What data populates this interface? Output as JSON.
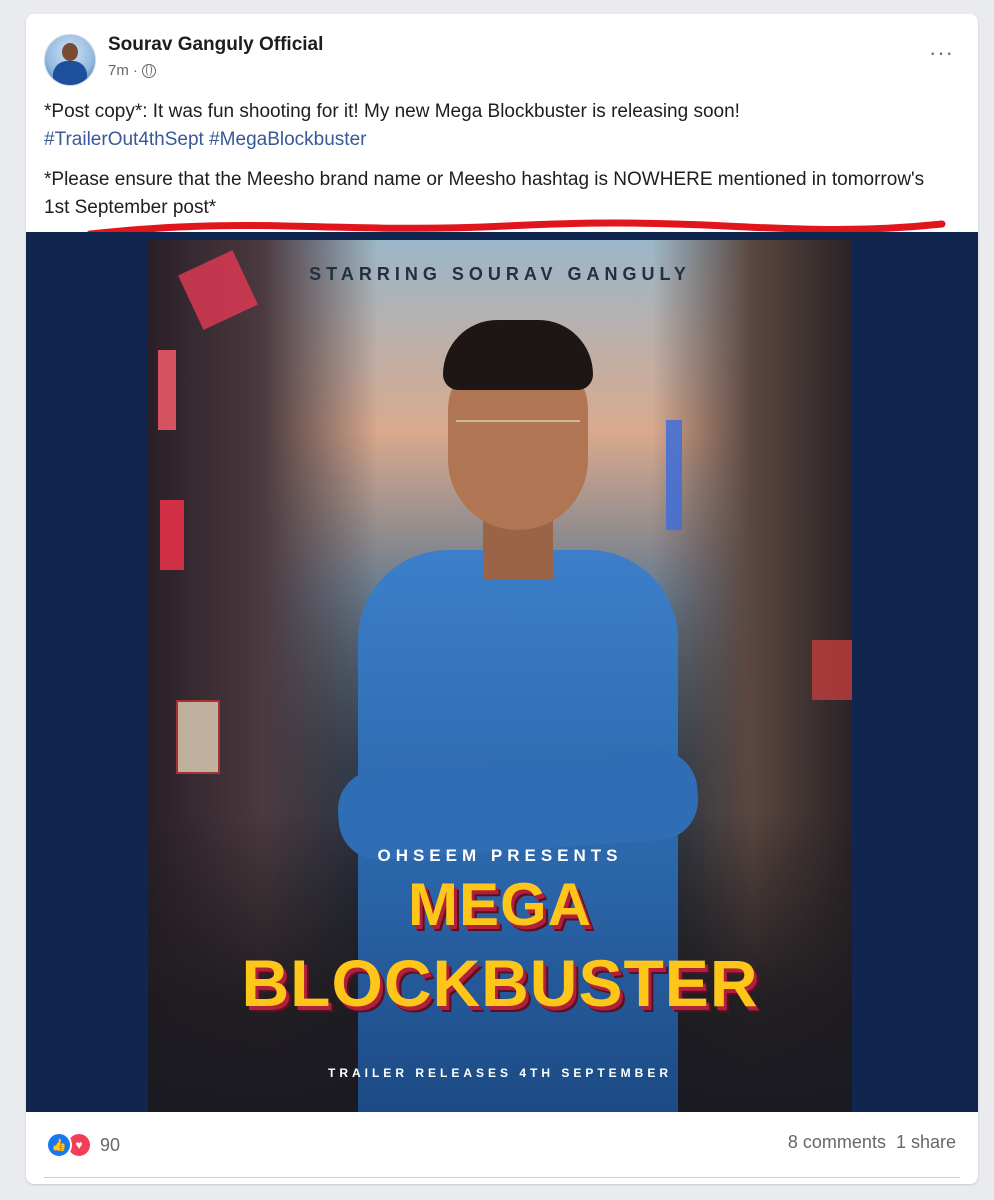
{
  "post": {
    "author": "Sourav Ganguly Official",
    "time": "7m",
    "separator": "·",
    "more_label": "···",
    "copy_line1": "*Post copy*: It was fun shooting for it! My new Mega Blockbuster is releasing soon!",
    "hashtags": [
      "#TrailerOut4thSept",
      "#MegaBlockbuster"
    ],
    "copy_line2": "*Please ensure  that the Meesho brand name or Meesho hashtag is NOWHERE mentioned in tomorrow's 1st September post*"
  },
  "poster": {
    "starring": "STARRING SOURAV GANGULY",
    "presents": "OHSEEM PRESENTS",
    "title_line1": "MEGA",
    "title_line2": "BLOCKBUSTER",
    "release": "TRAILER RELEASES 4TH SEPTEMBER"
  },
  "footer": {
    "reaction_count": "90",
    "comments": "8 comments",
    "shares": "1 share"
  },
  "colors": {
    "link": "#385898",
    "underline": "#e0161c",
    "title": "#ffc61a",
    "like": "#1877f2",
    "love": "#f33e58"
  },
  "icons": {
    "privacy": "globe-icon",
    "like": "like-icon",
    "love": "love-icon",
    "more": "more-icon"
  }
}
